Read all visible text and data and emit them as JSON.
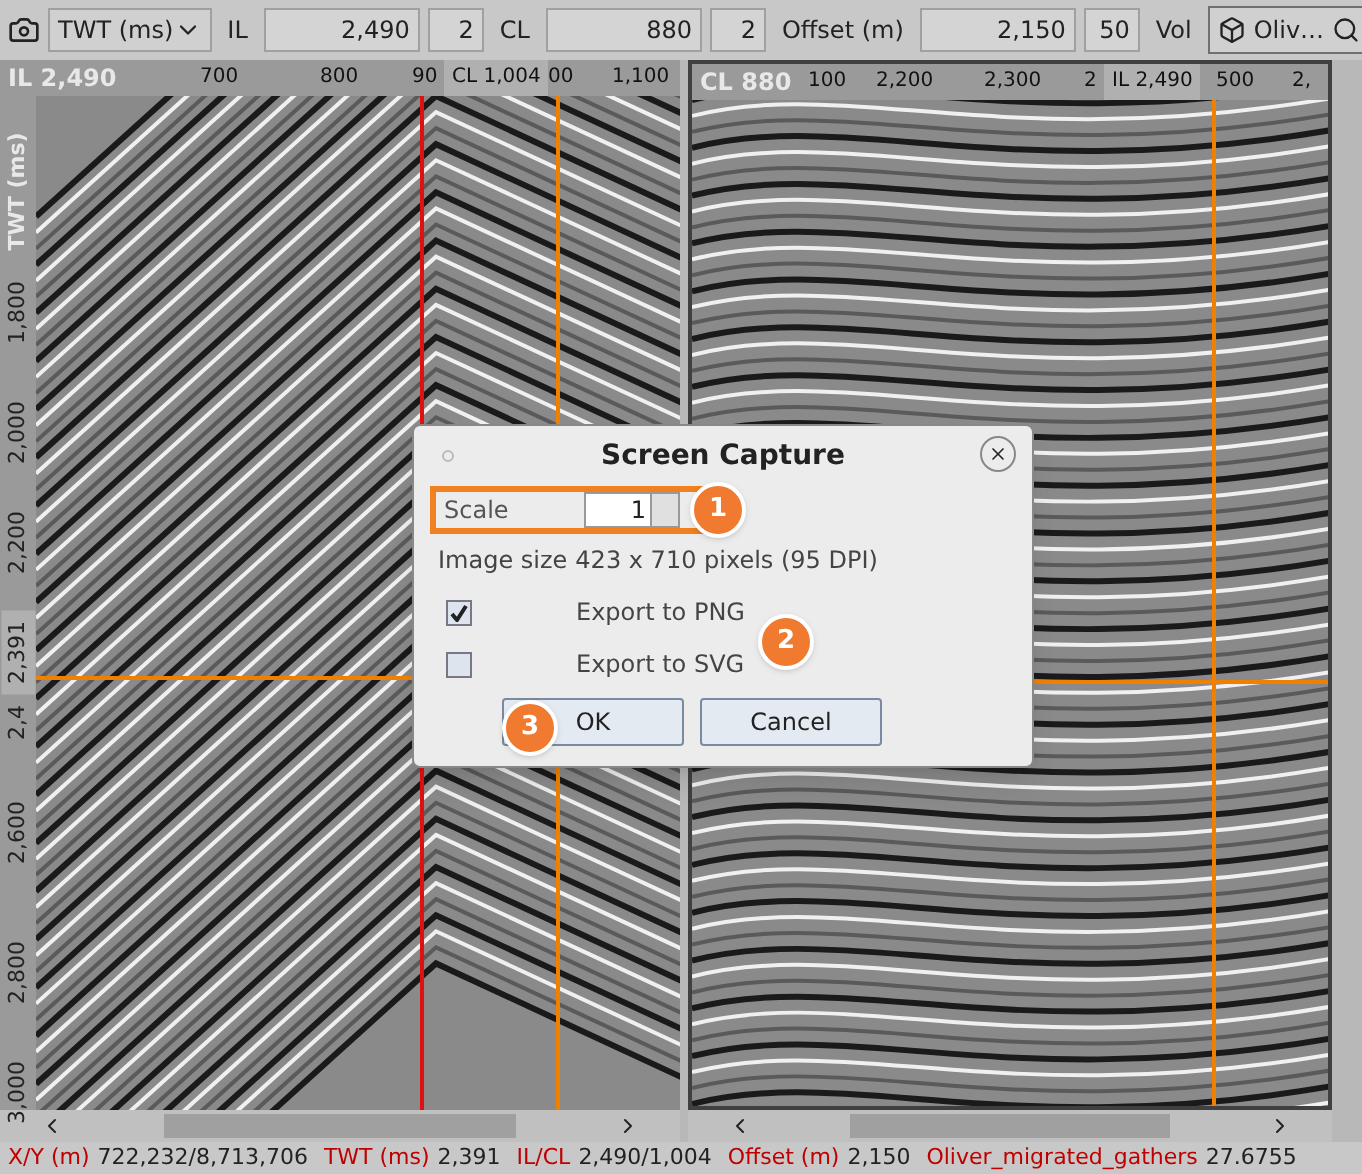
{
  "toolbar": {
    "domain": "TWT (ms)",
    "fields": [
      {
        "label": "IL",
        "value": "2,490",
        "step": "2"
      },
      {
        "label": "CL",
        "value": "880",
        "step": "2"
      },
      {
        "label": "Offset (m)",
        "value": "2,150",
        "step": "50"
      }
    ],
    "volume_label": "Vol",
    "volume": "Oliv…"
  },
  "left_panel": {
    "title": "IL 2,490",
    "ticks": [
      {
        "label": "700",
        "kind": "tick"
      },
      {
        "label": "800",
        "kind": "tick"
      },
      {
        "label": "90",
        "kind": "tick"
      },
      {
        "label": "CL 1,004",
        "kind": "cursor"
      },
      {
        "label": "00",
        "kind": "tick"
      },
      {
        "label": "1,100",
        "kind": "tick"
      }
    ]
  },
  "right_panel": {
    "title": "CL 880",
    "ticks": [
      {
        "label": "100",
        "kind": "tick"
      },
      {
        "label": "2,200",
        "kind": "tick"
      },
      {
        "label": "2,300",
        "kind": "tick"
      },
      {
        "label": "2",
        "kind": "tick"
      },
      {
        "label": "IL 2,490",
        "kind": "cursor"
      },
      {
        "label": "500",
        "kind": "tick"
      },
      {
        "label": "2,",
        "kind": "tick"
      }
    ]
  },
  "y_axis": {
    "title": "TWT (ms)",
    "ticks": [
      {
        "label": "1,800",
        "kind": "tick"
      },
      {
        "label": "2,000",
        "kind": "tick"
      },
      {
        "label": "2,200",
        "kind": "tick"
      },
      {
        "label": "2,391",
        "kind": "cursor"
      },
      {
        "label": "2,4",
        "kind": "tick"
      },
      {
        "label": "2,600",
        "kind": "tick"
      },
      {
        "label": "2,800",
        "kind": "tick"
      },
      {
        "label": "3,000",
        "kind": "tick"
      }
    ]
  },
  "dialog": {
    "title": "Screen Capture",
    "scale_label": "Scale",
    "scale_value": "1",
    "size_label": "Image size",
    "size_value": "423 x 710 pixels (95 DPI)",
    "checkboxes": [
      {
        "label": "Export to PNG",
        "checked": true
      },
      {
        "label": "Export to SVG",
        "checked": false
      }
    ],
    "buttons": [
      "OK",
      "Cancel"
    ]
  },
  "callouts": [
    "1",
    "2",
    "3"
  ],
  "status_bar": [
    {
      "label": "X/Y (m)",
      "value": "722,232/8,713,706"
    },
    {
      "label": "TWT (ms)",
      "value": "2,391"
    },
    {
      "label": "IL/CL",
      "value": "2,490/1,004"
    },
    {
      "label": "Offset (m)",
      "value": "2,150"
    },
    {
      "label": "Oliver_migrated_gathers",
      "value": "27.6755"
    }
  ]
}
